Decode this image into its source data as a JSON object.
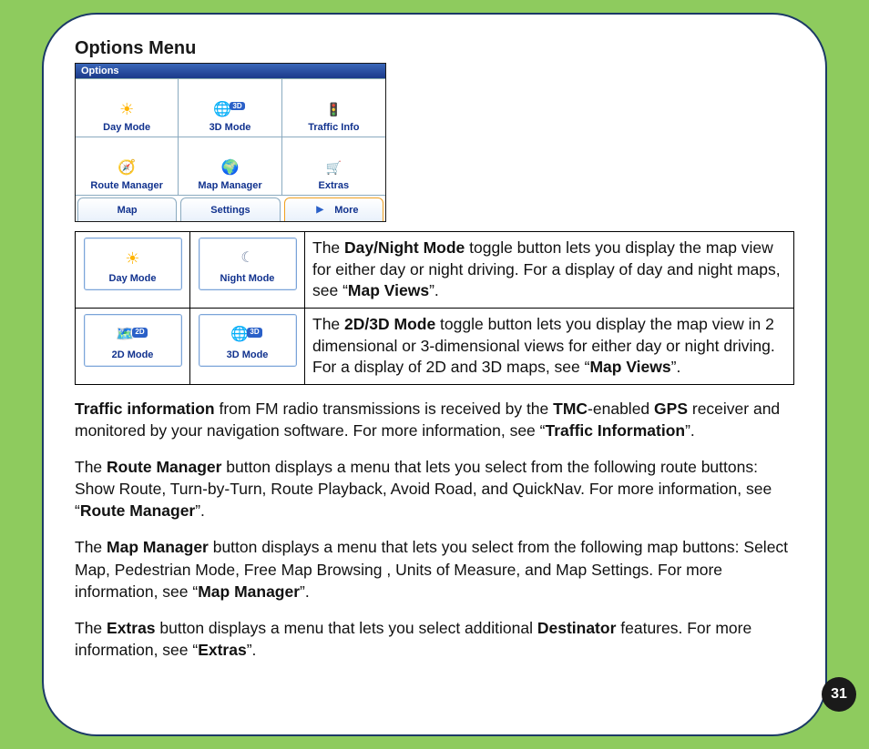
{
  "heading": "Options Menu",
  "options_window": {
    "title": "Options",
    "items": [
      {
        "label": "Day Mode",
        "icon": "sun"
      },
      {
        "label": "3D Mode",
        "icon": "globe3d",
        "badge": "3D"
      },
      {
        "label": "Traffic Info",
        "icon": "traffic"
      },
      {
        "label": "Route Manager",
        "icon": "route"
      },
      {
        "label": "Map Manager",
        "icon": "mapmgr"
      },
      {
        "label": "Extras",
        "icon": "extras"
      }
    ],
    "tabs": [
      {
        "label": "Map"
      },
      {
        "label": "Settings"
      },
      {
        "label": "More",
        "more": true
      }
    ]
  },
  "table": {
    "rows": [
      {
        "btn1": {
          "label": "Day Mode",
          "icon": "sun"
        },
        "btn2": {
          "label": "Night Mode",
          "icon": "moon"
        },
        "desc_pre": "The ",
        "desc_b1": "Day/Night Mode",
        "desc_mid": " toggle button lets you display the map view for either day or night driving. For a display of day and night maps, see “",
        "desc_b2": "Map Views",
        "desc_end": "”."
      },
      {
        "btn1": {
          "label": "2D Mode",
          "icon": "globe2d",
          "badge": "2D"
        },
        "btn2": {
          "label": "3D Mode",
          "icon": "globe3d",
          "badge": "3D"
        },
        "desc_pre": "The ",
        "desc_b1": "2D/3D Mode",
        "desc_mid": " toggle button lets you display the map view in 2 dimensional or 3-dimensional views for either day or night driving. For a display of 2D and 3D maps, see “",
        "desc_b2": "Map Views",
        "desc_end": "”."
      }
    ]
  },
  "paras": {
    "p1": {
      "b1": "Traffic information",
      "t1": " from FM radio transmissions is received by the ",
      "b2": "TMC",
      "t2": "-enabled ",
      "b3": "GPS",
      "t3": " receiver and monitored by your navigation software. For more information, see “",
      "b4": "Traffic Information",
      "t4": "”."
    },
    "p2": {
      "t1": "The ",
      "b1": "Route Manager",
      "t2": " button displays a menu that lets you select from the following route buttons: Show Route, Turn-by-Turn, Route Playback, Avoid Road, and QuickNav. For more information, see “",
      "b2": "Route Manager",
      "t3": "”."
    },
    "p3": {
      "t1": "The ",
      "b1": "Map Manager",
      "t2": " button displays a menu that lets you select from the following map buttons: Select Map, Pedestrian Mode, Free Map Browsing , Units of Measure, and Map Settings. For more information, see “",
      "b2": "Map Manager",
      "t3": "”."
    },
    "p4": {
      "t1": "The ",
      "b1": "Extras",
      "t2": " button displays a menu that lets you select additional ",
      "b2": "Destinator",
      "t3": " features. For more information, see “",
      "b3": "Extras",
      "t4": "”."
    }
  },
  "page_number": "31"
}
